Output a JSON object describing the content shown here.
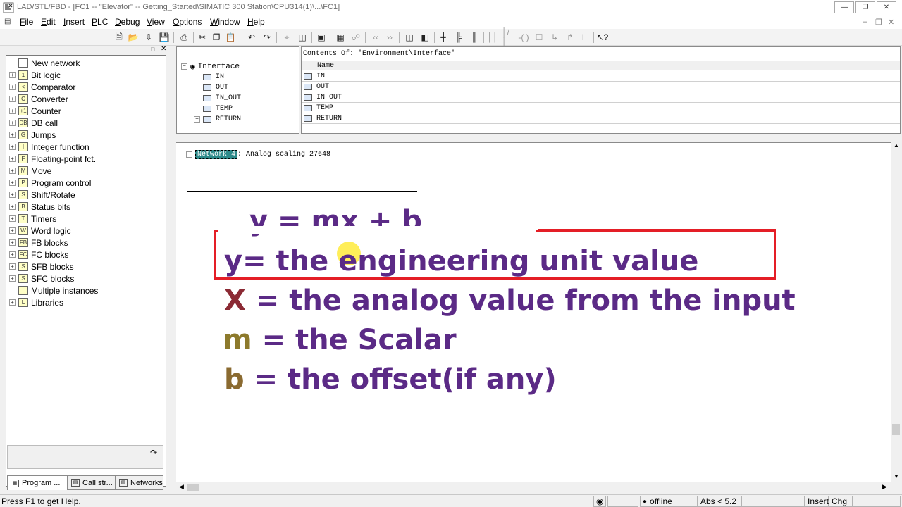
{
  "window": {
    "title": "LAD/STL/FBD  - [FC1 -- \"Elevator\" -- Getting_Started\\SIMATIC 300 Station\\CPU314(1)\\...\\FC1]"
  },
  "menu": {
    "items": [
      {
        "key": "F",
        "rest": "ile"
      },
      {
        "key": "E",
        "rest": "dit"
      },
      {
        "key": "I",
        "rest": "nsert"
      },
      {
        "key": "P",
        "rest": "LC"
      },
      {
        "key": "D",
        "rest": "ebug"
      },
      {
        "key": "V",
        "rest": "iew"
      },
      {
        "key": "O",
        "rest": "ptions"
      },
      {
        "key": "W",
        "rest": "indow"
      },
      {
        "key": "H",
        "rest": "elp"
      }
    ]
  },
  "catalog": {
    "items": [
      {
        "label": "New network",
        "icon": "new-network-icon",
        "expandable": false
      },
      {
        "label": "Bit logic",
        "icon": "bit-logic-icon",
        "expandable": true
      },
      {
        "label": "Comparator",
        "icon": "comparator-icon",
        "expandable": true
      },
      {
        "label": "Converter",
        "icon": "converter-icon",
        "expandable": true
      },
      {
        "label": "Counter",
        "icon": "counter-icon",
        "expandable": true
      },
      {
        "label": "DB call",
        "icon": "db-call-icon",
        "expandable": true
      },
      {
        "label": "Jumps",
        "icon": "jumps-icon",
        "expandable": true
      },
      {
        "label": "Integer function",
        "icon": "integer-function-icon",
        "expandable": true
      },
      {
        "label": "Floating-point fct.",
        "icon": "floating-point-icon",
        "expandable": true
      },
      {
        "label": "Move",
        "icon": "move-icon",
        "expandable": true
      },
      {
        "label": "Program control",
        "icon": "program-control-icon",
        "expandable": true
      },
      {
        "label": "Shift/Rotate",
        "icon": "shift-rotate-icon",
        "expandable": true
      },
      {
        "label": "Status bits",
        "icon": "status-bits-icon",
        "expandable": true
      },
      {
        "label": "Timers",
        "icon": "timers-icon",
        "expandable": true
      },
      {
        "label": "Word logic",
        "icon": "word-logic-icon",
        "expandable": true
      },
      {
        "label": "FB blocks",
        "icon": "fb-blocks-icon",
        "expandable": true
      },
      {
        "label": "FC blocks",
        "icon": "fc-blocks-icon",
        "expandable": true
      },
      {
        "label": "SFB blocks",
        "icon": "sfb-blocks-icon",
        "expandable": true
      },
      {
        "label": "SFC blocks",
        "icon": "sfc-blocks-icon",
        "expandable": true
      },
      {
        "label": "Multiple instances",
        "icon": "multiple-instances-icon",
        "expandable": false
      },
      {
        "label": "Libraries",
        "icon": "libraries-icon",
        "expandable": true
      }
    ],
    "tabs": [
      "Program ...",
      "Call str...",
      "Networks"
    ]
  },
  "interface": {
    "root": "Interface",
    "tree": [
      "IN",
      "OUT",
      "IN_OUT",
      "TEMP",
      "RETURN"
    ],
    "contents_header": "Contents Of: 'Environment\\Interface'",
    "column_name": "Name",
    "rows": [
      "IN",
      "OUT",
      "IN_OUT",
      "TEMP",
      "RETURN"
    ]
  },
  "network": {
    "badge": "Network 4",
    "title": ": Analog scaling 27648"
  },
  "overlay": {
    "formula": "y = mx + b",
    "line1_var": "y",
    "line1_text": "= the engineering unit value",
    "line2_var": "X",
    "line2_text": " = the analog value from the input",
    "line3_var": "m",
    "line3_text": " = the Scalar",
    "line4_var": "b",
    "line4_text": " = the offset(if any)",
    "colors": {
      "text": "#5b2a86",
      "x_var": "#8b2a34",
      "m_var": "#8d7a2c",
      "b_var": "#8a6a30",
      "highlight_box": "#e41e26"
    }
  },
  "status": {
    "help": "Press F1 to get Help.",
    "mode": "offline",
    "abs": "Abs < 5.2",
    "insert": "Insert",
    "chg": "Chg"
  }
}
